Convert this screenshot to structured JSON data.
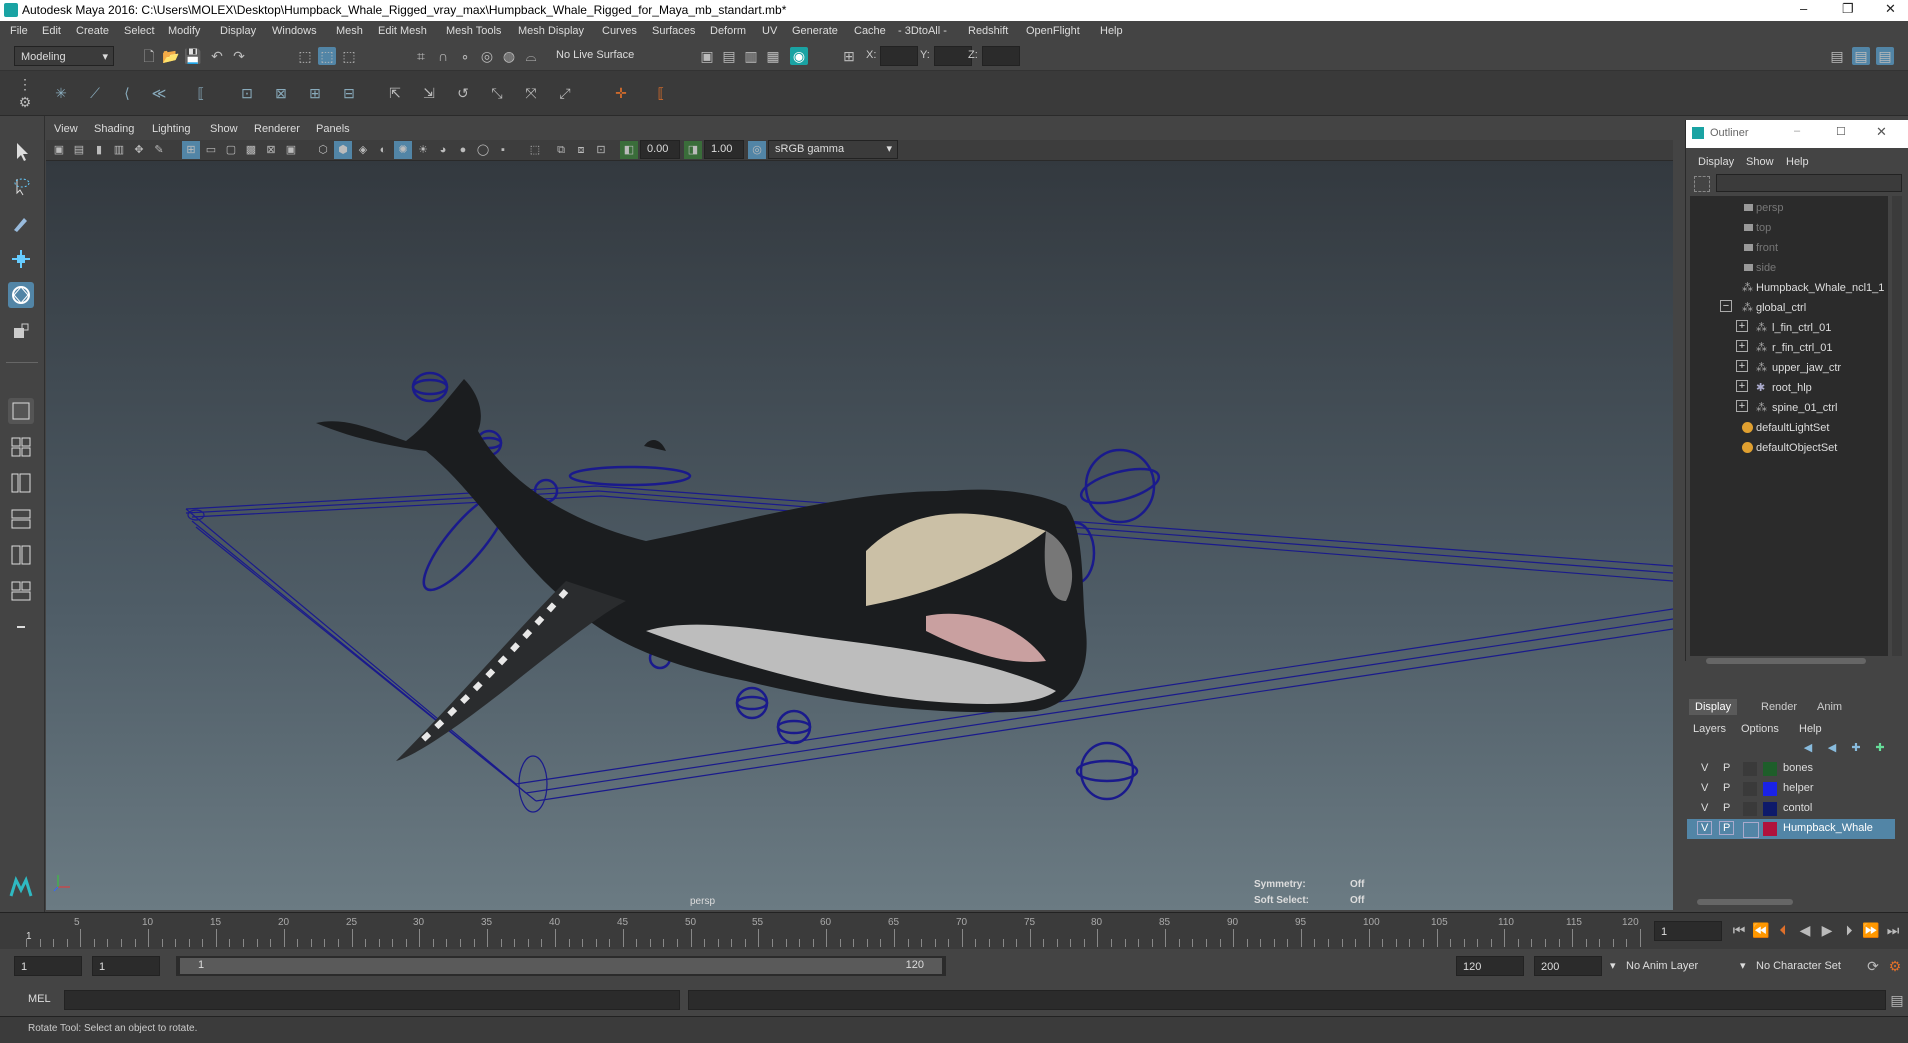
{
  "window": {
    "title": "Autodesk Maya 2016: C:\\Users\\MOLEX\\Desktop\\Humpback_Whale_Rigged_vray_max\\Humpback_Whale_Rigged_for_Maya_mb_standart.mb*",
    "controls": [
      "–",
      "❐",
      "✕"
    ]
  },
  "menubar": [
    "File",
    "Edit",
    "Create",
    "Select",
    "Modify",
    "Display",
    "Windows",
    "Mesh",
    "Edit Mesh",
    "Mesh Tools",
    "Mesh Display",
    "Curves",
    "Surfaces",
    "Deform",
    "UV",
    "Generate",
    "Cache",
    "- 3DtoAll -",
    "Redshift",
    "OpenFlight",
    "Help"
  ],
  "statusline": {
    "mode": "Modeling",
    "live_surface": "No Live Surface",
    "x_label": "X:",
    "y_label": "Y:",
    "z_label": "Z:"
  },
  "viewport": {
    "menu": [
      "View",
      "Shading",
      "Lighting",
      "Show",
      "Renderer",
      "Panels"
    ],
    "near_value": "0.00",
    "far_value": "1.00",
    "color_space": "sRGB gamma",
    "camera_label": "persp",
    "hud": {
      "symmetry_label": "Symmetry:",
      "symmetry_value": "Off",
      "soft_label": "Soft Select:",
      "soft_value": "Off"
    }
  },
  "outliner": {
    "title": "Outliner",
    "menu": [
      "Display",
      "Show",
      "Help"
    ],
    "items": [
      {
        "label": "persp",
        "dim": true,
        "indent": 0,
        "expander": ""
      },
      {
        "label": "top",
        "dim": true,
        "indent": 0,
        "expander": ""
      },
      {
        "label": "front",
        "dim": true,
        "indent": 0,
        "expander": ""
      },
      {
        "label": "side",
        "dim": true,
        "indent": 0,
        "expander": ""
      },
      {
        "label": "Humpback_Whale_ncl1_1",
        "dim": false,
        "indent": 0,
        "expander": ""
      },
      {
        "label": "global_ctrl",
        "dim": false,
        "indent": 0,
        "expander": "−"
      },
      {
        "label": "l_fin_ctrl_01",
        "dim": false,
        "indent": 1,
        "expander": "+"
      },
      {
        "label": "r_fin_ctrl_01",
        "dim": false,
        "indent": 1,
        "expander": "+"
      },
      {
        "label": "upper_jaw_ctr",
        "dim": false,
        "indent": 1,
        "expander": "+"
      },
      {
        "label": "root_hlp",
        "dim": false,
        "indent": 1,
        "expander": "+"
      },
      {
        "label": "spine_01_ctrl",
        "dim": false,
        "indent": 1,
        "expander": "+"
      },
      {
        "label": "defaultLightSet",
        "dim": false,
        "indent": 0,
        "expander": ""
      },
      {
        "label": "defaultObjectSet",
        "dim": false,
        "indent": 0,
        "expander": ""
      }
    ]
  },
  "layer_editor": {
    "tabs": [
      "Display",
      "Render",
      "Anim"
    ],
    "menu": [
      "Layers",
      "Options",
      "Help"
    ],
    "layers": [
      {
        "v": "V",
        "p": "P",
        "color": "#1e5e2a",
        "name": "bones",
        "selected": false
      },
      {
        "v": "V",
        "p": "P",
        "color": "#1a22e6",
        "name": "helper",
        "selected": false
      },
      {
        "v": "V",
        "p": "P",
        "color": "#0e1a6a",
        "name": "contol",
        "selected": false
      },
      {
        "v": "V",
        "p": "P",
        "color": "#b0123c",
        "name": "Humpback_Whale",
        "selected": true
      }
    ]
  },
  "timeline": {
    "ticks": [
      5,
      10,
      15,
      20,
      25,
      30,
      35,
      40,
      45,
      50,
      55,
      60,
      65,
      70,
      75,
      80,
      85,
      90,
      95,
      100,
      105,
      110,
      115,
      120
    ],
    "current_frame": "1",
    "current_frame_marker": "1"
  },
  "range": {
    "start": "1",
    "playback_start": "1",
    "slider_start": "1",
    "slider_end": "120",
    "playback_end": "120",
    "end": "200",
    "anim_layer": "No Anim Layer",
    "character_set": "No Character Set"
  },
  "command": {
    "label": "MEL"
  },
  "help_line": "Rotate Tool: Select an object to rotate.",
  "colors": {
    "accent": "#5285a6",
    "control_curve": "#1a1a8c"
  }
}
